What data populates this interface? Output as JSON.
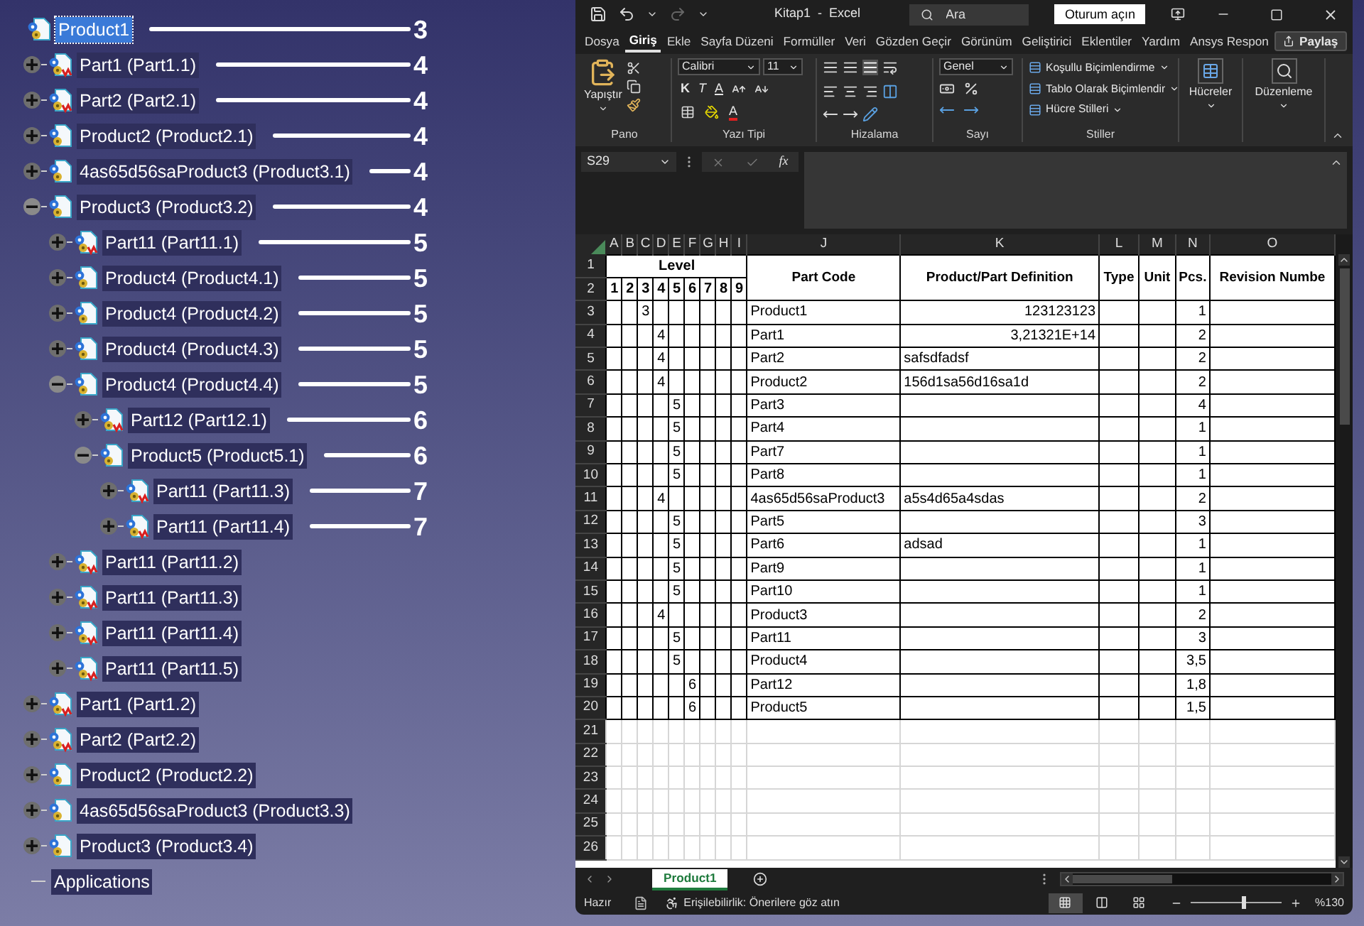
{
  "tree": {
    "items": [
      {
        "label": "Product1",
        "kind": "product",
        "selected": true,
        "annotation": "3",
        "children": [
          {
            "label": "Part1 (Part1.1)",
            "kind": "part",
            "selected": false,
            "expanded": false,
            "annotation": "4"
          },
          {
            "label": "Part2 (Part2.1)",
            "kind": "part",
            "selected": false,
            "expanded": false,
            "annotation": "4"
          },
          {
            "label": "Product2 (Product2.1)",
            "kind": "product",
            "selected": false,
            "expanded": false,
            "annotation": "4"
          },
          {
            "label": "4as65d56saProduct3 (Product3.1)",
            "kind": "product",
            "selected": false,
            "expanded": false,
            "annotation": "4"
          },
          {
            "label": "Product3 (Product3.2)",
            "kind": "product",
            "selected": false,
            "expanded": true,
            "annotation": "4",
            "children": [
              {
                "label": "Part11 (Part11.1)",
                "kind": "part",
                "selected": false,
                "expanded": false,
                "annotation": "5"
              },
              {
                "label": "Product4 (Product4.1)",
                "kind": "product",
                "selected": false,
                "expanded": false,
                "annotation": "5"
              },
              {
                "label": "Product4 (Product4.2)",
                "kind": "product",
                "selected": false,
                "expanded": false,
                "annotation": "5"
              },
              {
                "label": "Product4 (Product4.3)",
                "kind": "product",
                "selected": false,
                "expanded": false,
                "annotation": "5"
              },
              {
                "label": "Product4 (Product4.4)",
                "kind": "product",
                "selected": false,
                "expanded": true,
                "annotation": "5",
                "children": [
                  {
                    "label": "Part12 (Part12.1)",
                    "kind": "part",
                    "selected": false,
                    "expanded": false,
                    "annotation": "6"
                  },
                  {
                    "label": "Product5 (Product5.1)",
                    "kind": "product",
                    "selected": false,
                    "expanded": true,
                    "annotation": "6",
                    "children": [
                      {
                        "label": "Part11 (Part11.3)",
                        "kind": "part",
                        "selected": false,
                        "expanded": false,
                        "annotation": "7"
                      },
                      {
                        "label": "Part11 (Part11.4)",
                        "kind": "part",
                        "selected": false,
                        "expanded": false,
                        "annotation": "7"
                      }
                    ]
                  }
                ]
              },
              {
                "label": "Part11 (Part11.2)",
                "kind": "part",
                "selected": false,
                "expanded": false
              },
              {
                "label": "Part11 (Part11.3)",
                "kind": "part",
                "selected": false,
                "expanded": false
              },
              {
                "label": "Part11 (Part11.4)",
                "kind": "part",
                "selected": false,
                "expanded": false
              },
              {
                "label": "Part11 (Part11.5)",
                "kind": "part",
                "selected": false,
                "expanded": false
              }
            ]
          },
          {
            "label": "Part1 (Part1.2)",
            "kind": "part",
            "selected": false,
            "expanded": false
          },
          {
            "label": "Part2 (Part2.2)",
            "kind": "part",
            "selected": false,
            "expanded": false
          },
          {
            "label": "Product2 (Product2.2)",
            "kind": "product",
            "selected": false,
            "expanded": false
          },
          {
            "label": "4as65d56saProduct3 (Product3.3)",
            "kind": "product",
            "selected": false,
            "expanded": false
          },
          {
            "label": "Product3 (Product3.4)",
            "kind": "product",
            "selected": false,
            "expanded": false
          }
        ]
      },
      {
        "label": "Applications",
        "kind": "node",
        "selected": false
      }
    ]
  },
  "excel": {
    "title_bar": {
      "title": "Kitap1  -  Excel",
      "search_placeholder": "Ara",
      "sign_in": "Oturum açın"
    },
    "tabs": [
      {
        "label": "Dosya",
        "selected": false
      },
      {
        "label": "Giriş",
        "selected": true
      },
      {
        "label": "Ekle",
        "selected": false
      },
      {
        "label": "Sayfa Düzeni",
        "selected": false
      },
      {
        "label": "Formüller",
        "selected": false
      },
      {
        "label": "Veri",
        "selected": false
      },
      {
        "label": "Gözden Geçir",
        "selected": false
      },
      {
        "label": "Görünüm",
        "selected": false
      },
      {
        "label": "Geliştirici",
        "selected": false
      },
      {
        "label": "Eklentiler",
        "selected": false
      },
      {
        "label": "Yardım",
        "selected": false
      },
      {
        "label": "Ansys Respon",
        "selected": false
      }
    ],
    "share": "Paylaş",
    "ribbon": {
      "clipboard": {
        "paste": "Yapıştır",
        "label": "Pano"
      },
      "font": {
        "name": "Calibri",
        "size": "11",
        "bold": "K",
        "italic": "T",
        "underline": "A",
        "font_color_label": "A",
        "label": "Yazı Tipi"
      },
      "alignment": {
        "label": "Hizalama"
      },
      "number": {
        "format": "Genel",
        "label": "Sayı"
      },
      "styles": {
        "buttons": [
          "Koşullu Biçimlendirme",
          "Tablo Olarak Biçimlendir",
          "Hücre Stilleri"
        ],
        "label": "Stiller"
      },
      "cells": {
        "button": "Hücreler"
      },
      "editing": {
        "button": "Düzenleme"
      }
    },
    "name_box": "S29",
    "function_label": "fx",
    "sheet": {
      "columns": [
        "A",
        "B",
        "C",
        "D",
        "E",
        "F",
        "G",
        "H",
        "I",
        "J",
        "K",
        "L",
        "M",
        "N",
        "O"
      ],
      "header_rows": [
        "1",
        "2"
      ],
      "level_title": "Level",
      "level_numbers": [
        "1",
        "2",
        "3",
        "4",
        "5",
        "6",
        "7",
        "8",
        "9"
      ],
      "headers": [
        "Part Code",
        "Product/Part Definition",
        "Type",
        "Unit",
        "Pcs.",
        "Revision Numbe"
      ],
      "rows": [
        {
          "number": "3",
          "levels": [
            {
              "kind": "blank"
            },
            {
              "kind": "blank"
            },
            {
              "kind": "value",
              "text": "3"
            }
          ],
          "part_code": "Product1",
          "definition": {
            "text": "123123123",
            "kind": "number"
          },
          "pcs": "1"
        },
        {
          "number": "4",
          "levels": [
            {
              "kind": "blank"
            },
            {
              "kind": "blank"
            },
            {
              "kind": "blank"
            },
            {
              "kind": "value",
              "text": "4"
            }
          ],
          "part_code": "Part1",
          "definition": {
            "text": "3,21321E+14",
            "kind": "number"
          },
          "pcs": "2"
        },
        {
          "number": "5",
          "levels": [
            {
              "kind": "blank"
            },
            {
              "kind": "blank"
            },
            {
              "kind": "blank"
            },
            {
              "kind": "value",
              "text": "4"
            }
          ],
          "part_code": "Part2",
          "definition": {
            "text": "safsdfadsf",
            "kind": "text"
          },
          "pcs": "2"
        },
        {
          "number": "6",
          "levels": [
            {
              "kind": "blank"
            },
            {
              "kind": "blank"
            },
            {
              "kind": "blank"
            },
            {
              "kind": "value",
              "text": "4"
            }
          ],
          "part_code": "Product2",
          "definition": {
            "text": "156d1sa56d16sa1d",
            "kind": "text"
          },
          "pcs": "2"
        },
        {
          "number": "7",
          "levels": [
            {
              "kind": "blank"
            },
            {
              "kind": "blank"
            },
            {
              "kind": "blank"
            },
            {
              "kind": "blank"
            },
            {
              "kind": "value",
              "text": "5"
            }
          ],
          "part_code": "Part3",
          "pcs": "4"
        },
        {
          "number": "8",
          "levels": [
            {
              "kind": "blank"
            },
            {
              "kind": "blank"
            },
            {
              "kind": "blank"
            },
            {
              "kind": "blank"
            },
            {
              "kind": "value",
              "text": "5"
            }
          ],
          "part_code": "Part4",
          "pcs": "1"
        },
        {
          "number": "9",
          "levels": [
            {
              "kind": "blank"
            },
            {
              "kind": "blank"
            },
            {
              "kind": "blank"
            },
            {
              "kind": "blank"
            },
            {
              "kind": "value",
              "text": "5"
            }
          ],
          "part_code": "Part7",
          "pcs": "1"
        },
        {
          "number": "10",
          "levels": [
            {
              "kind": "blank"
            },
            {
              "kind": "blank"
            },
            {
              "kind": "blank"
            },
            {
              "kind": "blank"
            },
            {
              "kind": "value",
              "text": "5"
            }
          ],
          "part_code": "Part8",
          "pcs": "1"
        },
        {
          "number": "11",
          "levels": [
            {
              "kind": "blank"
            },
            {
              "kind": "blank"
            },
            {
              "kind": "blank"
            },
            {
              "kind": "value",
              "text": "4"
            }
          ],
          "part_code": "4as65d56saProduct3",
          "definition": {
            "text": "a5s4d65a4sdas",
            "kind": "text"
          },
          "pcs": "2"
        },
        {
          "number": "12",
          "levels": [
            {
              "kind": "blank"
            },
            {
              "kind": "blank"
            },
            {
              "kind": "blank"
            },
            {
              "kind": "blank"
            },
            {
              "kind": "value",
              "text": "5"
            }
          ],
          "part_code": "Part5",
          "pcs": "3"
        },
        {
          "number": "13",
          "levels": [
            {
              "kind": "blank"
            },
            {
              "kind": "blank"
            },
            {
              "kind": "blank"
            },
            {
              "kind": "blank"
            },
            {
              "kind": "value",
              "text": "5"
            }
          ],
          "part_code": "Part6",
          "definition": {
            "text": "adsad",
            "kind": "text"
          },
          "pcs": "1"
        },
        {
          "number": "14",
          "levels": [
            {
              "kind": "blank"
            },
            {
              "kind": "blank"
            },
            {
              "kind": "blank"
            },
            {
              "kind": "blank"
            },
            {
              "kind": "value",
              "text": "5"
            }
          ],
          "part_code": "Part9",
          "pcs": "1"
        },
        {
          "number": "15",
          "levels": [
            {
              "kind": "blank"
            },
            {
              "kind": "blank"
            },
            {
              "kind": "blank"
            },
            {
              "kind": "blank"
            },
            {
              "kind": "value",
              "text": "5"
            }
          ],
          "part_code": "Part10",
          "pcs": "1"
        },
        {
          "number": "16",
          "levels": [
            {
              "kind": "blank"
            },
            {
              "kind": "blank"
            },
            {
              "kind": "blank"
            },
            {
              "kind": "value",
              "text": "4"
            }
          ],
          "part_code": "Product3",
          "pcs": "2"
        },
        {
          "number": "17",
          "levels": [
            {
              "kind": "blank"
            },
            {
              "kind": "blank"
            },
            {
              "kind": "blank"
            },
            {
              "kind": "blank"
            },
            {
              "kind": "value",
              "text": "5"
            }
          ],
          "part_code": "Part11",
          "pcs": "3"
        },
        {
          "number": "18",
          "levels": [
            {
              "kind": "blank"
            },
            {
              "kind": "blank"
            },
            {
              "kind": "blank"
            },
            {
              "kind": "blank"
            },
            {
              "kind": "value",
              "text": "5"
            }
          ],
          "part_code": "Product4",
          "pcs": "3,5"
        },
        {
          "number": "19",
          "levels": [
            {
              "kind": "blank"
            },
            {
              "kind": "blank"
            },
            {
              "kind": "blank"
            },
            {
              "kind": "blank"
            },
            {
              "kind": "blank"
            },
            {
              "kind": "value",
              "text": "6"
            }
          ],
          "part_code": "Part12",
          "pcs": "1,8"
        },
        {
          "number": "20",
          "levels": [
            {
              "kind": "blank"
            },
            {
              "kind": "blank"
            },
            {
              "kind": "blank"
            },
            {
              "kind": "blank"
            },
            {
              "kind": "blank"
            },
            {
              "kind": "value",
              "text": "6"
            }
          ],
          "part_code": "Product5",
          "pcs": "1,5"
        }
      ],
      "empty_rows": [
        "21",
        "22",
        "23",
        "24",
        "25",
        "26"
      ]
    },
    "sheet_tabs": [
      {
        "label": "Product1",
        "selected": true
      }
    ],
    "status": {
      "ready": "Hazır",
      "accessibility": "Erişilebilirlik: Önerilere göz atın",
      "zoom": "%130",
      "zoom_slider": {
        "level": 0.58
      },
      "views": [
        {
          "kind": "normal",
          "selected": true
        },
        {
          "kind": "page_layout",
          "selected": false
        },
        {
          "kind": "page_break",
          "selected": false
        }
      ]
    }
  }
}
